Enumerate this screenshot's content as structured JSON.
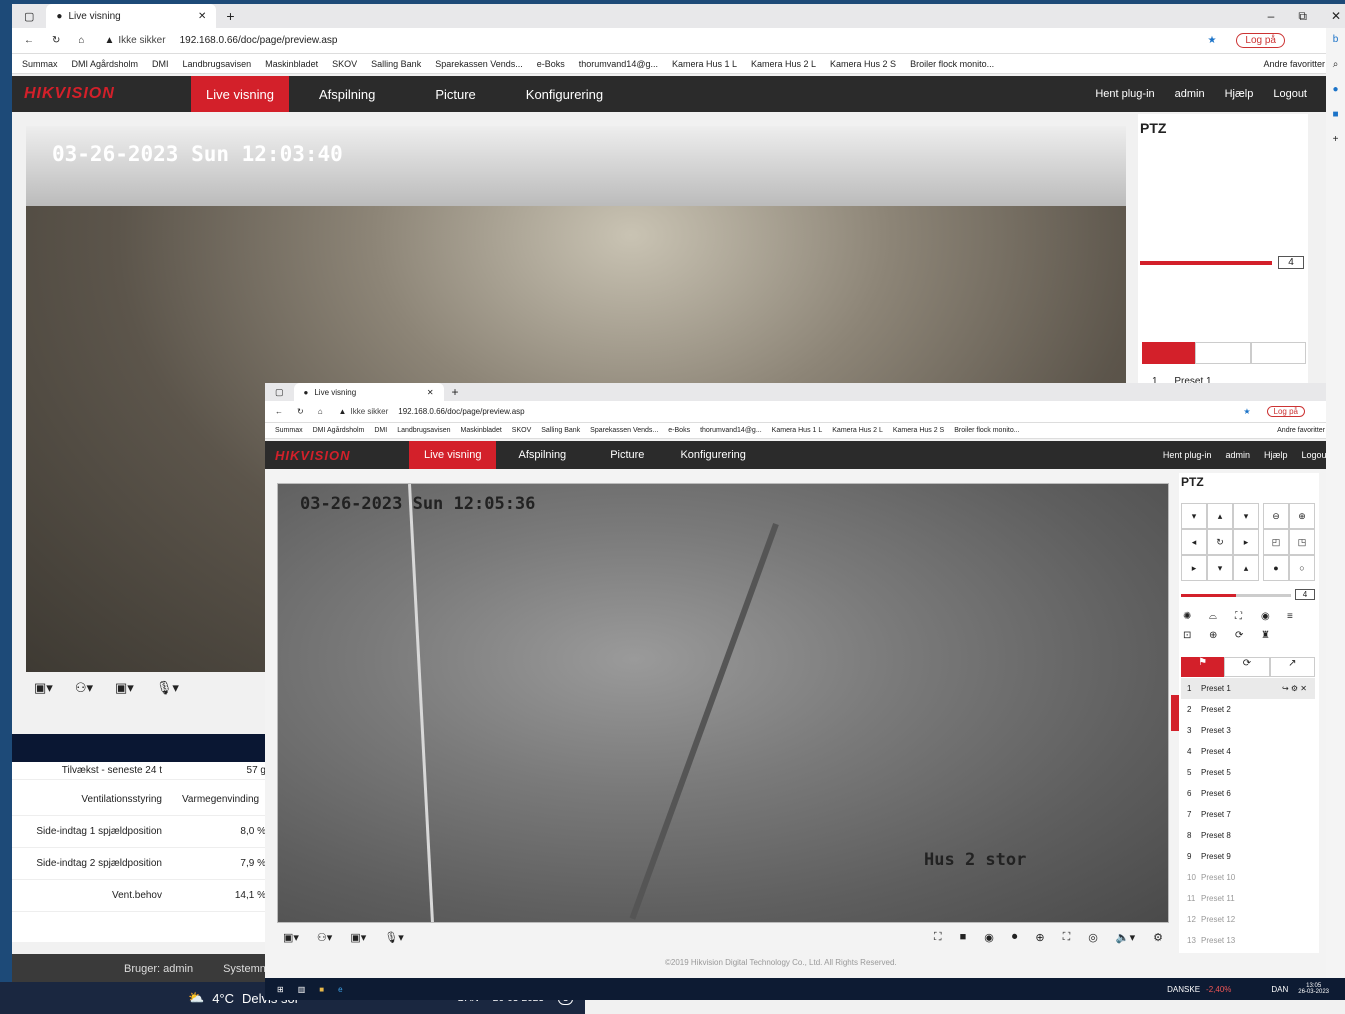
{
  "back_window": {
    "tab_title": "Live visning",
    "address_warning": "Ikke sikker",
    "url": "192.168.0.66/doc/page/preview.asp",
    "login_label": "Log på",
    "bookmarks": [
      "Summax",
      "DMI Agårdsholm",
      "DMI",
      "Landbrugsavisen",
      "Maskinbladet",
      "SKOV",
      "Salling Bank",
      "Sparekassen Vends...",
      "e-Boks",
      "thorumvand14@g...",
      "Kamera Hus 1 L",
      "Kamera Hus 2 L",
      "Kamera Hus 2 S",
      "Broiler flock monito..."
    ],
    "other_favorites": "Andre favoritter",
    "logo": "HIKVISION",
    "menu": [
      "Live visning",
      "Afspilning",
      "Picture",
      "Konfigurering"
    ],
    "right_menu": [
      "Hent plug-in",
      "admin",
      "Hjælp",
      "Logout"
    ],
    "osd_time": "03-26-2023 Sun 12:03:40",
    "ptz_title": "PTZ",
    "speed_value": "4",
    "preset_first": "Preset 1",
    "preset_first_num": "1"
  },
  "back_side_table": [
    {
      "label": "Tilvækst - seneste 24 t",
      "value": "57 g"
    },
    {
      "label": "Ventilationsstyring",
      "value": "Varmegenvinding"
    },
    {
      "label": "Side-indtag 1 spjældposition",
      "value": "8,0 %"
    },
    {
      "label": "Side-indtag 2 spjældposition",
      "value": "7,9 %"
    },
    {
      "label": "Vent.behov",
      "value": "14,1 %"
    }
  ],
  "back_footer": {
    "user": "Bruger: admin",
    "system": "Systemna"
  },
  "weather": {
    "temp": "4°C",
    "desc": "Delvis sol",
    "lang": "DAN",
    "date": "26-03-2023",
    "badge": "3"
  },
  "front_window": {
    "tab_title": "Live visning",
    "address_warning": "Ikke sikker",
    "url": "192.168.0.66/doc/page/preview.asp",
    "login_label": "Log på",
    "bookmarks": [
      "Summax",
      "DMI Agårdsholm",
      "DMI",
      "Landbrugsavisen",
      "Maskinbladet",
      "SKOV",
      "Salling Bank",
      "Sparekassen Vends...",
      "e-Boks",
      "thorumvand14@g...",
      "Kamera Hus 1 L",
      "Kamera Hus 2 L",
      "Kamera Hus 2 S",
      "Broiler flock monito..."
    ],
    "other_favorites": "Andre favoritter",
    "logo": "HIKVISION",
    "menu": [
      "Live visning",
      "Afspilning",
      "Picture",
      "Konfigurering"
    ],
    "right_menu": [
      "Hent plug-in",
      "admin",
      "Hjælp",
      "Logout"
    ],
    "osd_time": "03-26-2023 Sun 12:05:36",
    "osd_name": "Hus 2 stor",
    "ptz_title": "PTZ",
    "speed_value": "4",
    "presets": [
      {
        "num": "1",
        "name": "Preset 1"
      },
      {
        "num": "2",
        "name": "Preset 2"
      },
      {
        "num": "3",
        "name": "Preset 3"
      },
      {
        "num": "4",
        "name": "Preset 4"
      },
      {
        "num": "5",
        "name": "Preset 5"
      },
      {
        "num": "6",
        "name": "Preset 6"
      },
      {
        "num": "7",
        "name": "Preset 7"
      },
      {
        "num": "8",
        "name": "Preset 8"
      },
      {
        "num": "9",
        "name": "Preset 9"
      },
      {
        "num": "10",
        "name": "Preset 10"
      },
      {
        "num": "11",
        "name": "Preset 11"
      },
      {
        "num": "12",
        "name": "Preset 12"
      },
      {
        "num": "13",
        "name": "Preset 13"
      }
    ],
    "copyright": "©2019 Hikvision Digital Technology Co., Ltd. All Rights Reserved."
  },
  "taskbar2": {
    "stock": "DANSKE",
    "stock_change": "-2,40%",
    "lang": "DAN",
    "time": "13:05",
    "date": "26-03-2023"
  },
  "colors": {
    "accent": "#d3202a",
    "header": "#2b2b2b",
    "edge_blue": "#1b73c8"
  }
}
